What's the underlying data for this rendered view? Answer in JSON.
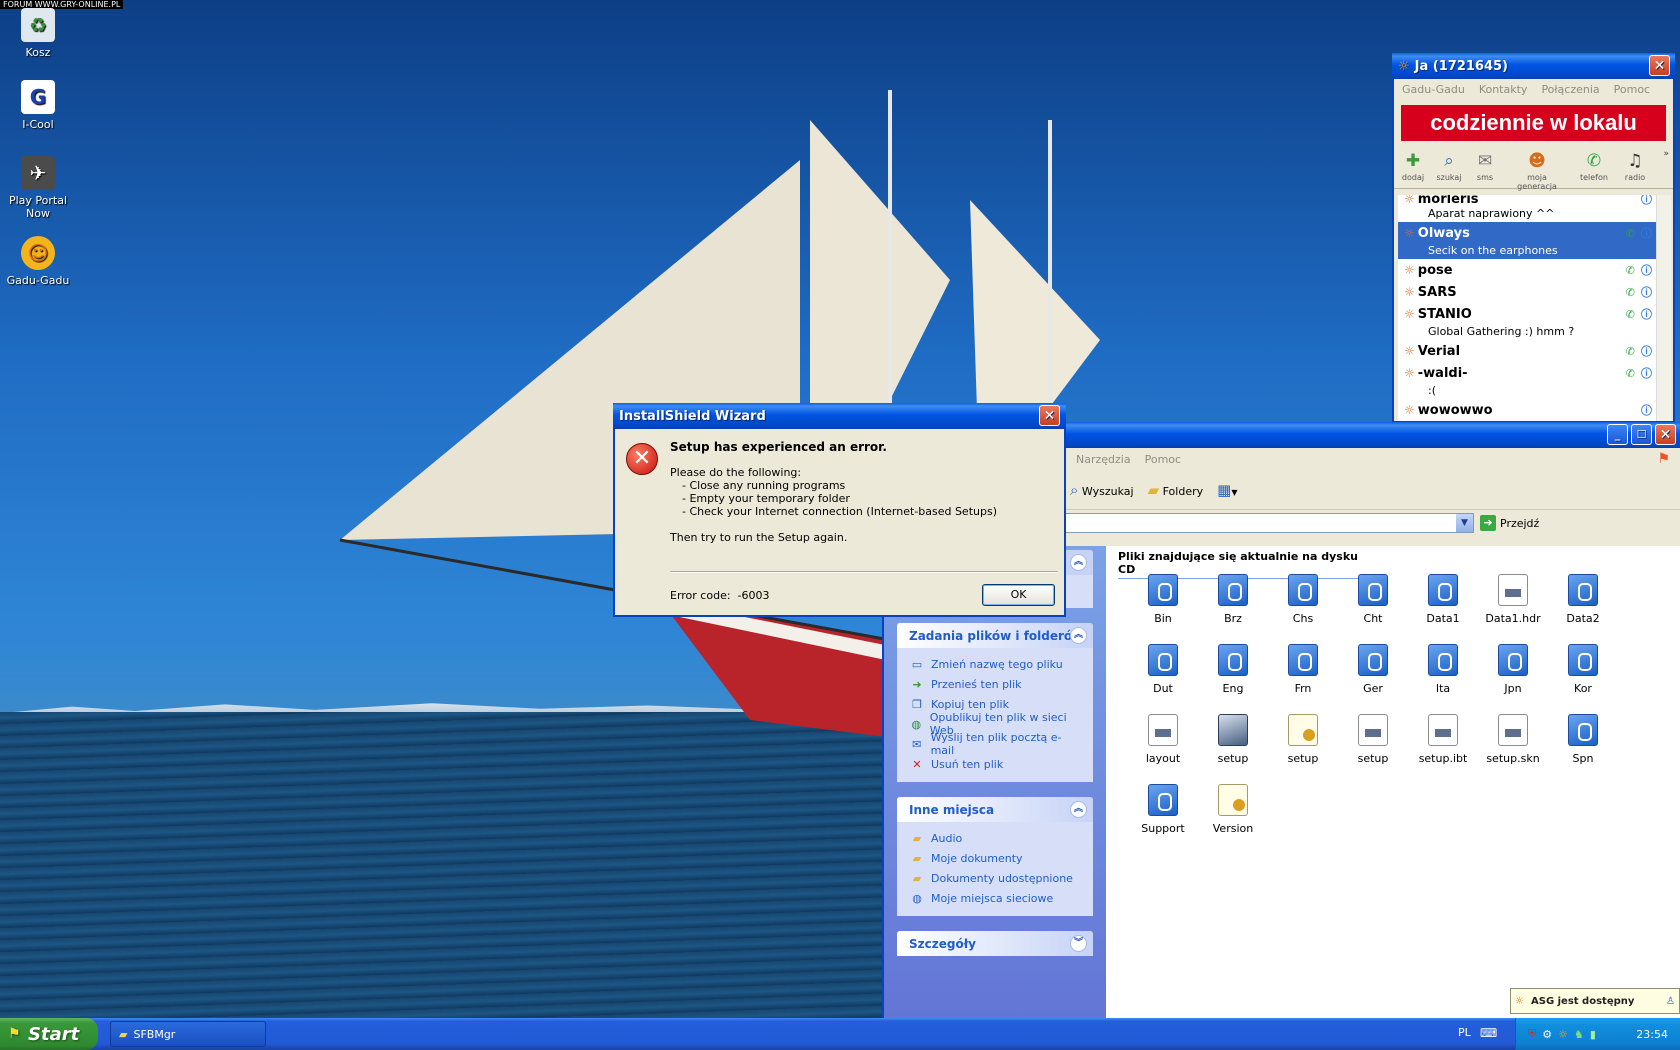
{
  "corner_label": "FORUM WWW.GRY-ONLINE.PL",
  "desktop_icons": [
    {
      "label": "Kosz",
      "icon": "recycle-bin-icon"
    },
    {
      "label": "I-Cool",
      "icon": "i-cool-icon"
    },
    {
      "label": "Play Portal Now",
      "icon": "play-portal-icon"
    },
    {
      "label": "Gadu-Gadu",
      "icon": "gadu-gadu-sun-icon"
    }
  ],
  "gg": {
    "title": "Ja (1721645)",
    "menu": [
      "Gadu-Gadu",
      "Kontakty",
      "Połączenia",
      "Pomoc"
    ],
    "banner": "codziennie w lokalu",
    "tools": [
      "dodaj",
      "szukaj",
      "sms",
      "moja generacja",
      "telefon",
      "radio"
    ],
    "contacts": [
      {
        "name": "morleris",
        "desc": "Aparat naprawiony ^^"
      },
      {
        "name": "Olways",
        "desc": "Secik on the earphones"
      },
      {
        "name": "pose",
        "desc": ""
      },
      {
        "name": "SARS",
        "desc": ""
      },
      {
        "name": "STANIO",
        "desc": "Global Gathering :) hmm ?"
      },
      {
        "name": "Verial",
        "desc": ""
      },
      {
        "name": "-waldi-",
        "desc": ":("
      },
      {
        "name": "wowowwo",
        "desc": ""
      }
    ]
  },
  "explorer": {
    "menu": [
      "Narzędzia",
      "Pomoc"
    ],
    "toolbar": {
      "search": "Wyszukaj",
      "folders": "Foldery"
    },
    "go_label": "Przejdź",
    "heading": "Pliki znajdujące się aktualnie na dysku CD",
    "panels": {
      "file_tasks": {
        "title": "Zadania plików i folderów",
        "items": [
          "Zmień nazwę tego pliku",
          "Przenieś ten plik",
          "Kopiuj ten plik",
          "Opublikuj ten plik w sieci Web",
          "Wyślij ten plik pocztą e-mail",
          "Usuń ten plik"
        ]
      },
      "other_places": {
        "title": "Inne miejsca",
        "items": [
          "Audio",
          "Moje dokumenty",
          "Dokumenty udostępnione",
          "Moje miejsca sieciowe"
        ]
      },
      "details": {
        "title": "Szczegóły"
      }
    },
    "files": [
      {
        "name": "Bin",
        "type": "cab"
      },
      {
        "name": "Brz",
        "type": "cab"
      },
      {
        "name": "Chs",
        "type": "cab"
      },
      {
        "name": "Cht",
        "type": "cab"
      },
      {
        "name": "Data1",
        "type": "cab"
      },
      {
        "name": "Data1.hdr",
        "type": "doc"
      },
      {
        "name": "Data2",
        "type": "cab"
      },
      {
        "name": "Dut",
        "type": "cab"
      },
      {
        "name": "Eng",
        "type": "cab"
      },
      {
        "name": "Frn",
        "type": "cab"
      },
      {
        "name": "Ger",
        "type": "cab"
      },
      {
        "name": "Ita",
        "type": "cab"
      },
      {
        "name": "Jpn",
        "type": "cab"
      },
      {
        "name": "Kor",
        "type": "cab"
      },
      {
        "name": "layout",
        "type": "doc"
      },
      {
        "name": "setup",
        "type": "app"
      },
      {
        "name": "setup",
        "type": "cfg"
      },
      {
        "name": "setup",
        "type": "doc"
      },
      {
        "name": "setup.ibt",
        "type": "doc"
      },
      {
        "name": "setup.skn",
        "type": "doc"
      },
      {
        "name": "Spn",
        "type": "cab"
      },
      {
        "name": "Support",
        "type": "cab"
      },
      {
        "name": "Version",
        "type": "cfg"
      }
    ]
  },
  "notify": "ASG jest dostępny",
  "dialog": {
    "title": "InstallShield Wizard",
    "heading": "Setup has experienced an error.",
    "intro": "Please do the following:",
    "steps": [
      "- Close any running programs",
      "- Empty your temporary folder",
      "- Check your Internet connection (Internet-based Setups)"
    ],
    "retry": "Then try to run the Setup again.",
    "error_code_label": "Error code:",
    "error_code": "-6003",
    "ok_label": "OK"
  },
  "taskbar": {
    "start_label": "Start",
    "task_label": "SFBMgr",
    "language": "PL",
    "clock": "23:54"
  }
}
